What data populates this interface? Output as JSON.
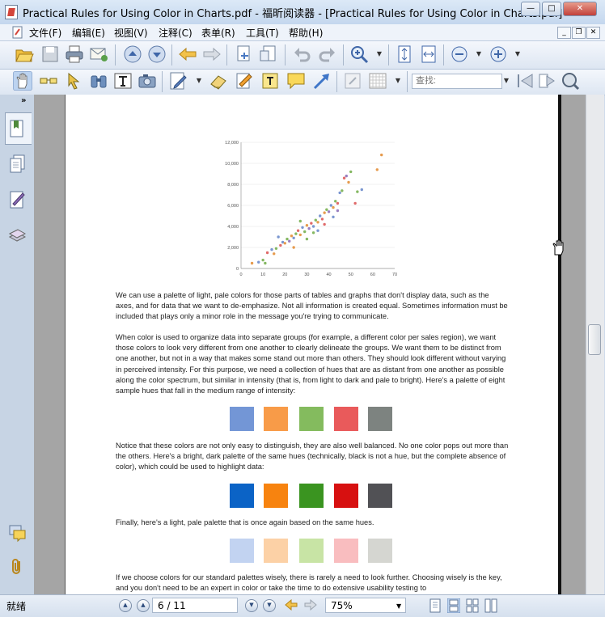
{
  "window": {
    "title": "Practical Rules for Using Color in Charts.pdf - 福昕阅读器 - [Practical Rules for Using Color in Charts.pdf]"
  },
  "menu": [
    "文件(F)",
    "编辑(E)",
    "视图(V)",
    "注释(C)",
    "表单(R)",
    "工具(T)",
    "帮助(H)"
  ],
  "search": {
    "placeholder": "查找:"
  },
  "document": {
    "paragraphs": [
      "We can use a palette of light, pale colors for those parts of tables and graphs that don't display data, such as the axes, and for data that we want to de-emphasize. Not all information is created equal. Sometimes information must be included that plays only a minor role in the message you're trying to communicate.",
      "When color is used to organize data into separate groups (for example, a different color per sales region), we want those colors to look very different from one another to clearly delineate the groups. We want them to be distinct from one another, but not in a way that makes some stand out more than others. They should look different without varying in perceived intensity. For this purpose, we need a collection of hues that are as distant from one another as possible along the color spectrum, but similar in intensity (that is, from light to dark and pale to bright). Here's a palette of eight sample hues that fall in the medium range of intensity:",
      "Notice that these colors are not only easy to distinguish, they are also well balanced. No one color pops out more than the others. Here's a bright, dark palette of the same hues (technically, black is not a hue, but the complete absence of color), which could be used to highlight data:",
      "Finally, here's a light, pale palette that is once again based on the same hues.",
      "If we choose colors for our standard palettes wisely, there is rarely a need to look further. Choosing wisely is the key, and you don't need to be an expert in color or take the time to do extensive usability testing to"
    ],
    "palettes": {
      "medium": [
        "#7396d6",
        "#f89b48",
        "#84bb5e",
        "#e95a5b",
        "#7d8380"
      ],
      "bright": [
        "#0b63c6",
        "#f7830f",
        "#3a9420",
        "#d71010",
        "#515155"
      ],
      "light": [
        "#c2d3f1",
        "#fcd1a6",
        "#c8e4a5",
        "#f9bdbf",
        "#d5d6d1"
      ]
    }
  },
  "chart_data": {
    "type": "scatter",
    "xlim": [
      0,
      70
    ],
    "ylim": [
      0,
      12000
    ],
    "x_ticks": [
      "0",
      "10",
      "20",
      "30",
      "40",
      "50",
      "60",
      "70"
    ],
    "y_ticks": [
      "0",
      "2,000",
      "4,000",
      "6,000",
      "8,000",
      "10,000",
      "12,000"
    ],
    "points": [
      [
        5,
        500,
        "#e69b4e"
      ],
      [
        8,
        600,
        "#7a96d0"
      ],
      [
        10,
        800,
        "#85b862"
      ],
      [
        12,
        1500,
        "#e06a6a"
      ],
      [
        14,
        1800,
        "#7a96d0"
      ],
      [
        15,
        1400,
        "#e69b4e"
      ],
      [
        16,
        1900,
        "#85b862"
      ],
      [
        18,
        2200,
        "#e06a6a"
      ],
      [
        19,
        2500,
        "#7a96d0"
      ],
      [
        20,
        2400,
        "#e69b4e"
      ],
      [
        21,
        2800,
        "#85b862"
      ],
      [
        22,
        2600,
        "#9a7fc0"
      ],
      [
        23,
        3100,
        "#e69b4e"
      ],
      [
        24,
        2900,
        "#7a96d0"
      ],
      [
        25,
        3300,
        "#85b862"
      ],
      [
        26,
        3600,
        "#e06a6a"
      ],
      [
        27,
        3200,
        "#e69b4e"
      ],
      [
        28,
        3900,
        "#7a96d0"
      ],
      [
        29,
        3500,
        "#85b862"
      ],
      [
        30,
        4100,
        "#e69b4e"
      ],
      [
        31,
        3800,
        "#9a7fc0"
      ],
      [
        32,
        4300,
        "#e06a6a"
      ],
      [
        33,
        4000,
        "#7a96d0"
      ],
      [
        34,
        4600,
        "#85b862"
      ],
      [
        35,
        4400,
        "#e69b4e"
      ],
      [
        36,
        5000,
        "#7a96d0"
      ],
      [
        37,
        4700,
        "#e06a6a"
      ],
      [
        38,
        5300,
        "#e69b4e"
      ],
      [
        39,
        5600,
        "#85b862"
      ],
      [
        40,
        5400,
        "#9a7fc0"
      ],
      [
        41,
        6000,
        "#7a96d0"
      ],
      [
        42,
        5800,
        "#e69b4e"
      ],
      [
        43,
        6400,
        "#85b862"
      ],
      [
        44,
        6200,
        "#e06a6a"
      ],
      [
        45,
        7200,
        "#7a96d0"
      ],
      [
        46,
        7400,
        "#85b862"
      ],
      [
        47,
        8600,
        "#e06a6a"
      ],
      [
        48,
        8800,
        "#9a7fc0"
      ],
      [
        50,
        9200,
        "#85b862"
      ],
      [
        52,
        6200,
        "#e06a6a"
      ],
      [
        55,
        7500,
        "#7a96d0"
      ],
      [
        62,
        9400,
        "#e69b4e"
      ],
      [
        64,
        10800,
        "#e69b4e"
      ],
      [
        11,
        500,
        "#85b862"
      ],
      [
        17,
        3000,
        "#7a96d0"
      ],
      [
        24,
        2000,
        "#e69b4e"
      ],
      [
        33,
        3400,
        "#85b862"
      ],
      [
        38,
        4200,
        "#e06a6a"
      ],
      [
        42,
        4900,
        "#7a96d0"
      ],
      [
        49,
        8200,
        "#e69b4e"
      ],
      [
        53,
        7300,
        "#85b862"
      ],
      [
        27,
        4500,
        "#85b862"
      ],
      [
        30,
        2800,
        "#85b862"
      ],
      [
        35,
        3600,
        "#7a96d0"
      ],
      [
        44,
        5500,
        "#9a7fc0"
      ]
    ]
  },
  "status": {
    "text": "就绪",
    "page": "6 / 11",
    "zoom": "75%"
  }
}
